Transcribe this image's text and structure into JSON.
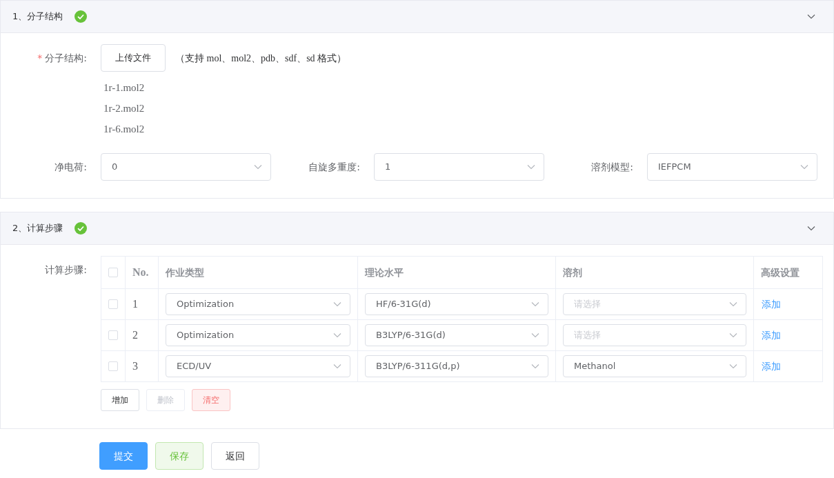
{
  "sections": [
    {
      "title": "1、分子结构",
      "complete": true,
      "expanded": true
    },
    {
      "title": "2、计算步骤",
      "complete": true,
      "expanded": true
    }
  ],
  "structure": {
    "label": "分子结构:",
    "required_mark": "*",
    "upload_button": "上传文件",
    "hint": "（支持 mol、mol2、pdb、sdf、sd 格式）",
    "files": [
      "1r-1.mol2",
      "1r-2.mol2",
      "1r-6.mol2"
    ]
  },
  "params": [
    {
      "label": "净电荷:",
      "value": "0"
    },
    {
      "label": "自旋多重度:",
      "value": "1"
    },
    {
      "label": "溶剂模型:",
      "value": "IEFPCM"
    }
  ],
  "steps": {
    "label": "计算步骤:",
    "header_checked": false,
    "columns": [
      "No.",
      "作业类型",
      "理论水平",
      "溶剂",
      "高级设置"
    ],
    "rows": [
      {
        "checked": false,
        "no": "1",
        "job_type": "Optimization",
        "level_of_theory": "HF/6-31G(d)",
        "solvent": {
          "placeholder": "请选择"
        },
        "advanced": "添加"
      },
      {
        "checked": false,
        "no": "2",
        "job_type": "Optimization",
        "level_of_theory": "B3LYP/6-31G(d)",
        "solvent": {
          "placeholder": "请选择"
        },
        "advanced": "添加"
      },
      {
        "checked": false,
        "no": "3",
        "job_type": "ECD/UV",
        "level_of_theory": "B3LYP/6-311G(d,p)",
        "solvent": {
          "value": "Methanol"
        },
        "advanced": "添加"
      }
    ],
    "buttons": [
      {
        "label": "增加",
        "kind": "default",
        "disabled": false
      },
      {
        "label": "删除",
        "kind": "default",
        "disabled": true
      },
      {
        "label": "清空",
        "kind": "danger",
        "disabled": false
      }
    ]
  },
  "actions": [
    {
      "label": "提交",
      "kind": "primary"
    },
    {
      "label": "保存",
      "kind": "success"
    },
    {
      "label": "返回",
      "kind": "default"
    }
  ]
}
